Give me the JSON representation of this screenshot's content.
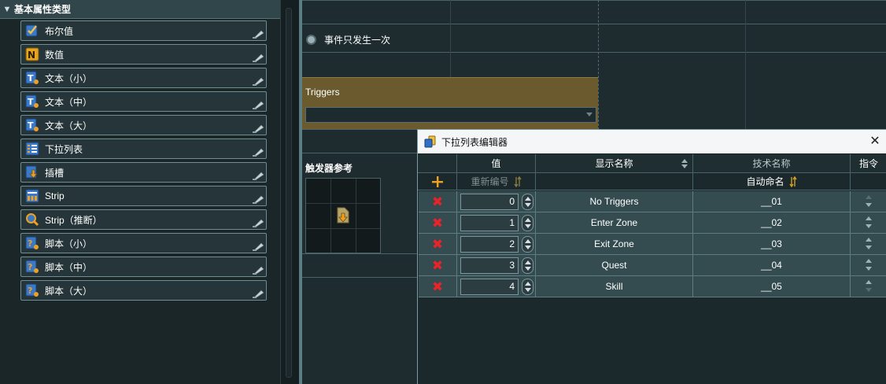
{
  "left_panel": {
    "header": "基本属性类型",
    "items": [
      {
        "label": "布尔值",
        "icon": "checkbox-icon"
      },
      {
        "label": "数值",
        "icon": "number-icon"
      },
      {
        "label": "文本（小）",
        "icon": "text-small-icon"
      },
      {
        "label": "文本（中）",
        "icon": "text-medium-icon"
      },
      {
        "label": "文本（大）",
        "icon": "text-large-icon"
      },
      {
        "label": "下拉列表",
        "icon": "list-icon"
      },
      {
        "label": "插槽",
        "icon": "slot-icon"
      },
      {
        "label": "Strip",
        "icon": "strip-icon"
      },
      {
        "label": "Strip（推断）",
        "icon": "strip-infer-icon"
      },
      {
        "label": "脚本（小）",
        "icon": "script-small-icon"
      },
      {
        "label": "脚本（中）",
        "icon": "script-medium-icon"
      },
      {
        "label": "脚本（大）",
        "icon": "script-large-icon"
      }
    ]
  },
  "middle": {
    "event_once_label": "事件只发生一次",
    "triggers_label": "Triggers",
    "triggers_value": "",
    "trigger_ref_label": "触发器参考"
  },
  "dialog": {
    "title": "下拉列表编辑器",
    "columns": {
      "value": "值",
      "display_name": "显示名称",
      "tech_name": "技术名称",
      "command": "指令"
    },
    "renumber_label": "重新编号",
    "auto_name_label": "自动命名",
    "rows": [
      {
        "value": "0",
        "display": "No Triggers",
        "tech": "__01"
      },
      {
        "value": "1",
        "display": "Enter Zone",
        "tech": "__02"
      },
      {
        "value": "2",
        "display": "Exit Zone",
        "tech": "__03"
      },
      {
        "value": "3",
        "display": "Quest",
        "tech": "__04"
      },
      {
        "value": "4",
        "display": "Skill",
        "tech": "__05"
      }
    ]
  },
  "colors": {
    "accent_orange": "#f0a020",
    "delete_red": "#e8232a",
    "triggers_bg": "#6a5a2e"
  }
}
